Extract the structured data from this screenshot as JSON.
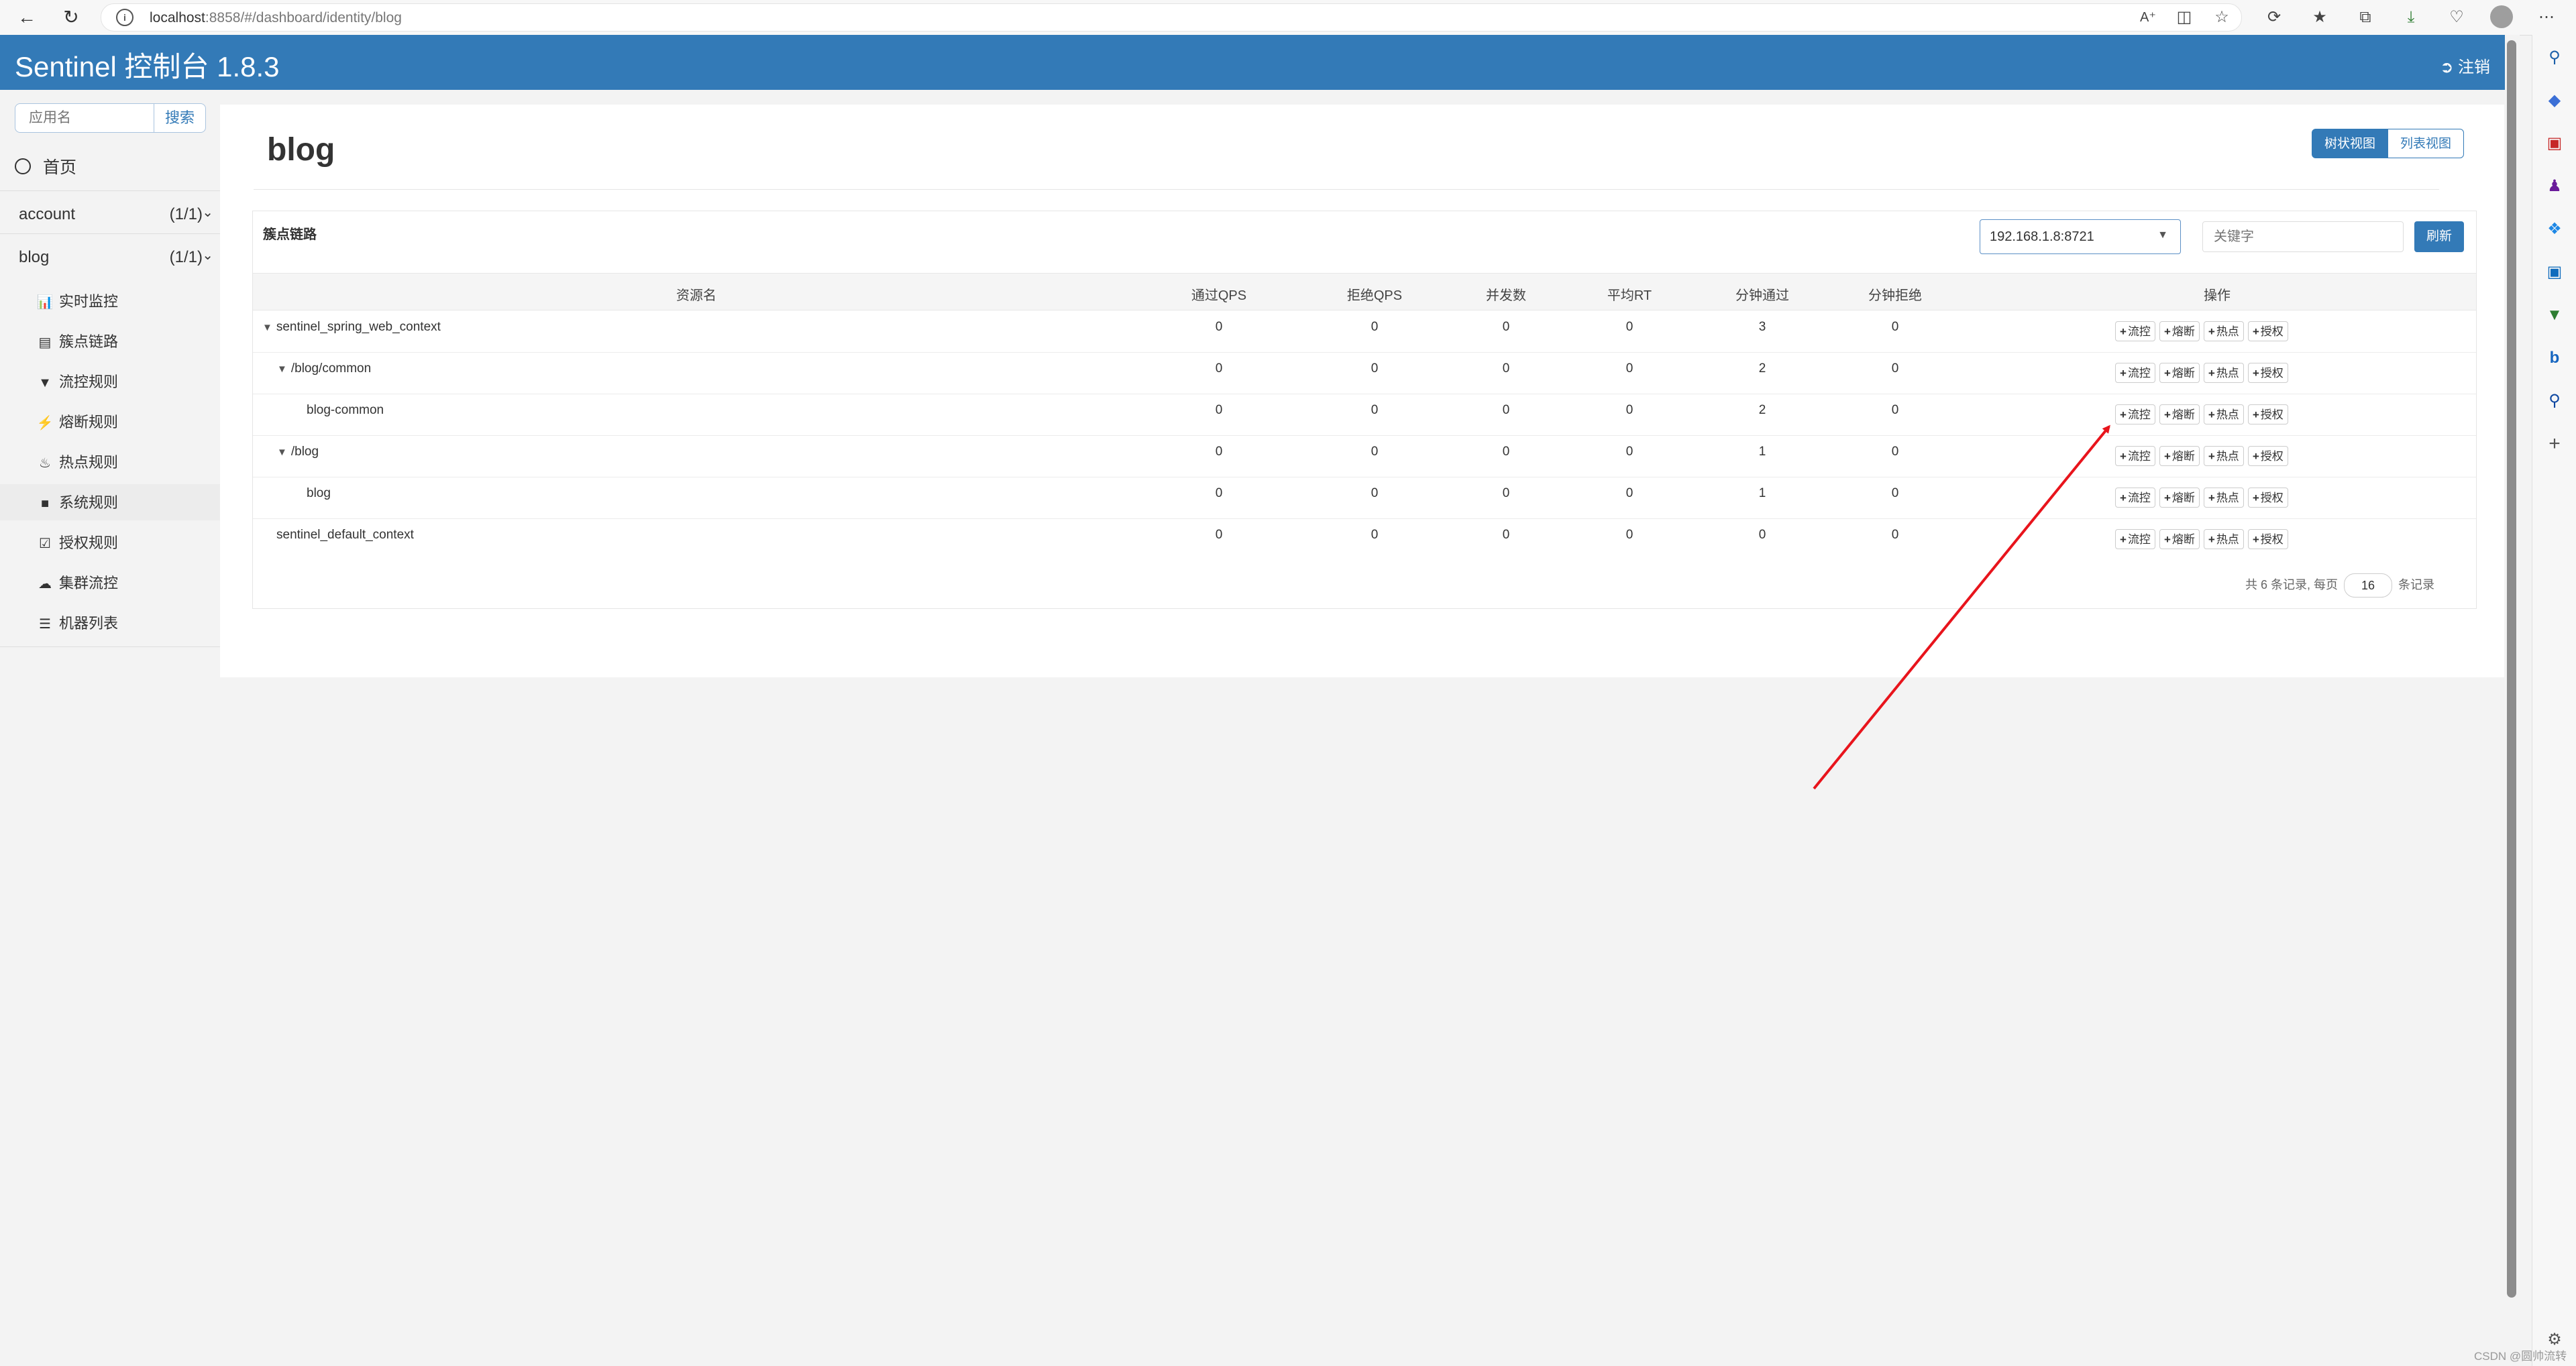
{
  "browser": {
    "url_host": "localhost",
    "url_path": ":8858/#/dashboard/identity/blog",
    "toolbar_icons": [
      "read-aloud-icon",
      "split-screen-icon",
      "favorite-star-icon",
      "extensions-icon",
      "favorites-icon",
      "collections-icon",
      "downloads-icon",
      "browser-essentials-icon",
      "profile-avatar",
      "more-icon"
    ],
    "side_icons": [
      "search-icon",
      "shopping-tag-icon",
      "tools-briefcase-icon",
      "persons-icon",
      "copilot-icon",
      "outlook-icon",
      "drop-icon",
      "bing-icon",
      "search-blue-icon",
      "add-icon"
    ]
  },
  "header": {
    "brand": "Sentinel 控制台 1.8.3",
    "logout": "注销"
  },
  "sidebar": {
    "search_placeholder": "应用名",
    "search_button": "搜索",
    "home": "首页",
    "apps": [
      {
        "name": "account",
        "count": "(1/1)"
      },
      {
        "name": "blog",
        "count": "(1/1)"
      }
    ],
    "menu": [
      {
        "label": "实时监控",
        "icon": "bar-chart-icon"
      },
      {
        "label": "簇点链路",
        "icon": "list-icon"
      },
      {
        "label": "流控规则",
        "icon": "filter-icon"
      },
      {
        "label": "熔断规则",
        "icon": "bolt-icon"
      },
      {
        "label": "热点规则",
        "icon": "fire-icon"
      },
      {
        "label": "系统规则",
        "icon": "lock-icon"
      },
      {
        "label": "授权规则",
        "icon": "check-square-icon"
      },
      {
        "label": "集群流控",
        "icon": "cloud-icon"
      },
      {
        "label": "机器列表",
        "icon": "th-list-icon"
      }
    ]
  },
  "main": {
    "title": "blog",
    "view_tree": "树状视图",
    "view_list": "列表视图",
    "card_title": "簇点链路",
    "machine": "192.168.1.8:8721",
    "keyword_placeholder": "关键字",
    "refresh": "刷新",
    "columns": [
      "资源名",
      "通过QPS",
      "拒绝QPS",
      "并发数",
      "平均RT",
      "分钟通过",
      "分钟拒绝",
      "操作"
    ],
    "op_buttons": [
      "流控",
      "熔断",
      "热点",
      "授权"
    ],
    "rows": [
      {
        "name": "sentinel_spring_web_context",
        "toggle": "▼",
        "level": 0,
        "values": [
          "0",
          "0",
          "0",
          "0",
          "3",
          "0"
        ]
      },
      {
        "name": "/blog/common",
        "toggle": "▼",
        "level": 1,
        "values": [
          "0",
          "0",
          "0",
          "0",
          "2",
          "0"
        ]
      },
      {
        "name": "blog-common",
        "toggle": "",
        "level": 2,
        "values": [
          "0",
          "0",
          "0",
          "0",
          "2",
          "0"
        ]
      },
      {
        "name": "/blog",
        "toggle": "▼",
        "level": 1,
        "values": [
          "0",
          "0",
          "0",
          "0",
          "1",
          "0"
        ]
      },
      {
        "name": "blog",
        "toggle": "",
        "level": 2,
        "values": [
          "0",
          "0",
          "0",
          "0",
          "1",
          "0"
        ]
      },
      {
        "name": "sentinel_default_context",
        "toggle": "",
        "level": 0,
        "values": [
          "0",
          "0",
          "0",
          "0",
          "0",
          "0"
        ]
      }
    ],
    "pager_prefix": "共 6 条记录, 每页",
    "pager_size": "16",
    "pager_suffix": "条记录"
  },
  "annotation_color": "#e8141c",
  "watermark": "CSDN @圆帅流转"
}
